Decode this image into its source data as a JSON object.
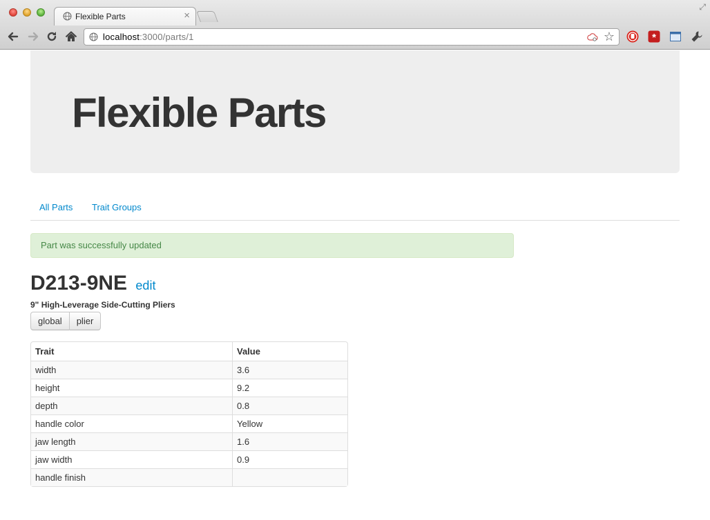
{
  "browser": {
    "tab_title": "Flexible Parts",
    "tab_close": "×",
    "url_host": "localhost",
    "url_rest": ":3000/parts/1",
    "icons": [
      "back-icon",
      "forward-icon",
      "reload-icon",
      "home-icon",
      "globe-icon",
      "cloud-icon",
      "star-icon",
      "stop-extension-icon",
      "lastpass-icon",
      "window-icon",
      "wrench-icon"
    ]
  },
  "header": {
    "title": "Flexible Parts"
  },
  "nav": {
    "all_parts": "All Parts",
    "trait_groups": "Trait Groups"
  },
  "alert": {
    "message": "Part was successfully updated"
  },
  "part": {
    "number": "D213-9NE",
    "edit_label": "edit",
    "description": "9\" High-Leverage Side-Cutting Pliers",
    "tags": [
      "global",
      "plier"
    ]
  },
  "table": {
    "headers": [
      "Trait",
      "Value"
    ],
    "rows": [
      [
        "width",
        "3.6"
      ],
      [
        "height",
        "9.2"
      ],
      [
        "depth",
        "0.8"
      ],
      [
        "handle color",
        "Yellow"
      ],
      [
        "jaw length",
        "1.6"
      ],
      [
        "jaw width",
        "0.9"
      ],
      [
        "handle finish",
        ""
      ]
    ]
  },
  "colors": {
    "link": "#0088cc",
    "alert_bg": "#dff0d8",
    "alert_text": "#468847",
    "hero_bg": "#eeeeee"
  }
}
